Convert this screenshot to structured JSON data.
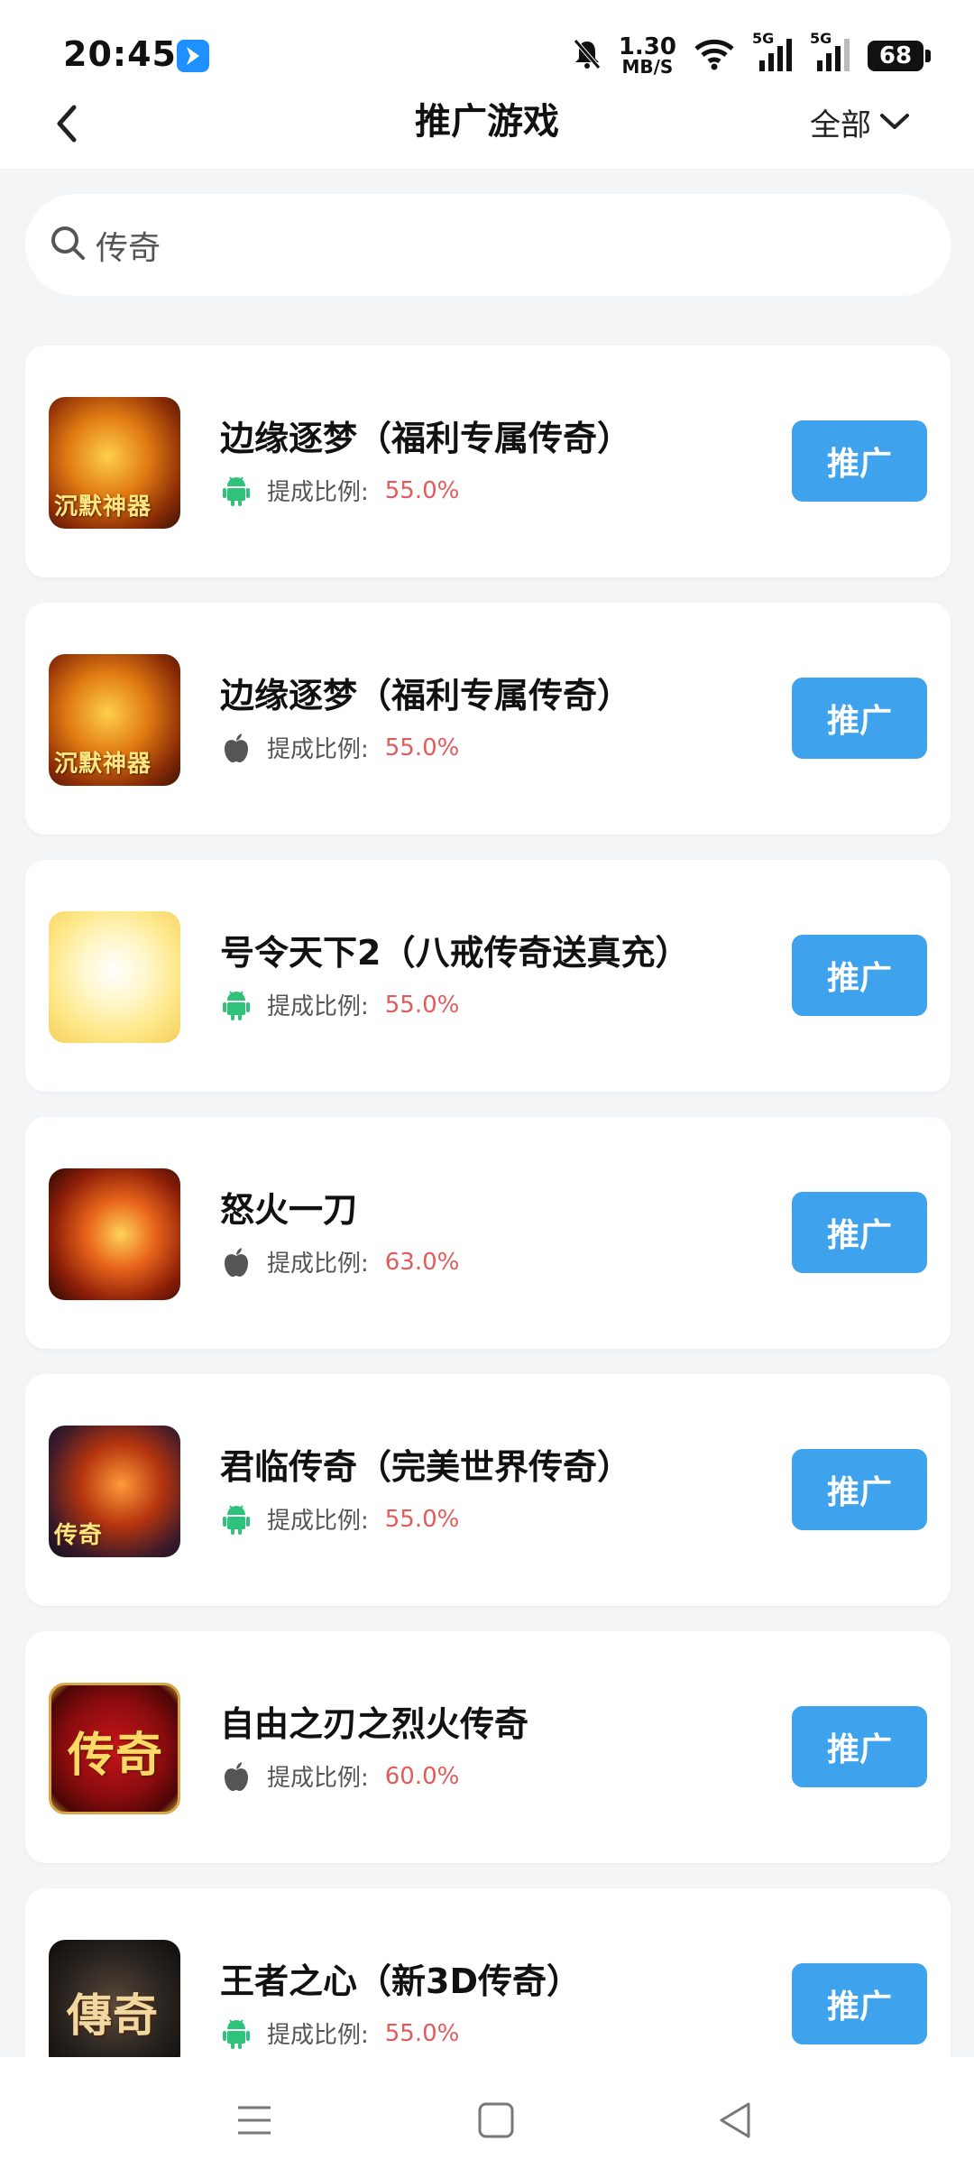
{
  "status_bar": {
    "time": "20:45",
    "net_speed_value": "1.30",
    "net_speed_unit": "MB/S",
    "signal_1_label": "5G",
    "signal_2_label": "5G",
    "battery": "68",
    "icons": [
      "app-notification-icon",
      "mute-icon",
      "wifi-icon",
      "signal-icon",
      "battery-icon"
    ]
  },
  "header": {
    "title": "推广游戏",
    "filter_label": "全部"
  },
  "search": {
    "value": "传奇"
  },
  "colors": {
    "accent": "#3ea2ec",
    "ratio": "#e15b5b",
    "android": "#2fc27a",
    "apple": "#555555"
  },
  "games": [
    {
      "name": "边缘逐梦（福利专属传奇）",
      "platform": "android",
      "ratio_label": "提成比例:",
      "ratio": "55.0%",
      "button": "推广",
      "thumb_text": "沉默神器"
    },
    {
      "name": "边缘逐梦（福利专属传奇）",
      "platform": "apple",
      "ratio_label": "提成比例:",
      "ratio": "55.0%",
      "button": "推广",
      "thumb_text": "沉默神器"
    },
    {
      "name": "号令天下2（八戒传奇送真充）",
      "platform": "android",
      "ratio_label": "提成比例:",
      "ratio": "55.0%",
      "button": "推广",
      "thumb_text": ""
    },
    {
      "name": "怒火一刀",
      "platform": "apple",
      "ratio_label": "提成比例:",
      "ratio": "63.0%",
      "button": "推广",
      "thumb_text": ""
    },
    {
      "name": "君临传奇（完美世界传奇）",
      "platform": "android",
      "ratio_label": "提成比例:",
      "ratio": "55.0%",
      "button": "推广",
      "thumb_text": "传奇"
    },
    {
      "name": "自由之刃之烈火传奇",
      "platform": "apple",
      "ratio_label": "提成比例:",
      "ratio": "60.0%",
      "button": "推广",
      "thumb_text": "传奇"
    },
    {
      "name": "王者之心（新3D传奇）",
      "platform": "android",
      "ratio_label": "提成比例:",
      "ratio": "55.0%",
      "button": "推广",
      "thumb_text": "傳奇"
    }
  ]
}
